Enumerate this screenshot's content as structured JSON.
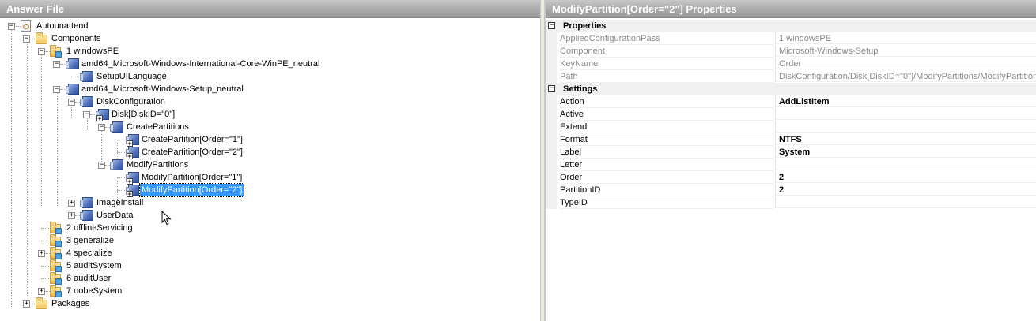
{
  "left_pane": {
    "title": "Answer File",
    "tree": [
      {
        "label": "Autounattend",
        "icon": "answer-file-icon"
      },
      {
        "label": "Components",
        "icon": "folder-icon"
      },
      {
        "label": "1 windowsPE",
        "icon": "config-pass-icon"
      },
      {
        "label": "amd64_Microsoft-Windows-International-Core-WinPE_neutral",
        "icon": "component-icon"
      },
      {
        "label": "SetupUILanguage",
        "icon": "component-icon"
      },
      {
        "label": "amd64_Microsoft-Windows-Setup_neutral",
        "icon": "component-icon"
      },
      {
        "label": "DiskConfiguration",
        "icon": "component-icon"
      },
      {
        "label": "Disk[DiskID=\"0\"]",
        "icon": "list-item-icon"
      },
      {
        "label": "CreatePartitions",
        "icon": "component-icon"
      },
      {
        "label": "CreatePartition[Order=\"1\"]",
        "icon": "list-item-icon"
      },
      {
        "label": "CreatePartition[Order=\"2\"]",
        "icon": "list-item-icon"
      },
      {
        "label": "ModifyPartitions",
        "icon": "component-icon"
      },
      {
        "label": "ModifyPartition[Order=\"1\"]",
        "icon": "list-item-icon"
      },
      {
        "label": "ModifyPartition[Order=\"2\"]",
        "icon": "list-item-icon",
        "selected": true
      },
      {
        "label": "ImageInstall",
        "icon": "component-icon"
      },
      {
        "label": "UserData",
        "icon": "component-icon"
      },
      {
        "label": "2 offlineServicing",
        "icon": "config-pass-icon"
      },
      {
        "label": "3 generalize",
        "icon": "config-pass-icon"
      },
      {
        "label": "4 specialize",
        "icon": "config-pass-icon"
      },
      {
        "label": "5 auditSystem",
        "icon": "config-pass-icon"
      },
      {
        "label": "6 auditUser",
        "icon": "config-pass-icon"
      },
      {
        "label": "7 oobeSystem",
        "icon": "config-pass-icon"
      },
      {
        "label": "Packages",
        "icon": "folder-icon"
      }
    ]
  },
  "right_pane": {
    "title": "ModifyPartition[Order=\"2\"] Properties",
    "categories": [
      {
        "name": "Properties",
        "rows": [
          {
            "name": "AppliedConfigurationPass",
            "value": "1 windowsPE"
          },
          {
            "name": "Component",
            "value": "Microsoft-Windows-Setup"
          },
          {
            "name": "KeyName",
            "value": "Order"
          },
          {
            "name": "Path",
            "value": "DiskConfiguration/Disk[DiskID=\"0\"]/ModifyPartitions/ModifyPartition"
          }
        ]
      },
      {
        "name": "Settings",
        "rows": [
          {
            "name": "Action",
            "value": "AddListItem"
          },
          {
            "name": "Active",
            "value": ""
          },
          {
            "name": "Extend",
            "value": ""
          },
          {
            "name": "Format",
            "value": "NTFS"
          },
          {
            "name": "Label",
            "value": "System"
          },
          {
            "name": "Letter",
            "value": ""
          },
          {
            "name": "Order",
            "value": "2"
          },
          {
            "name": "PartitionID",
            "value": "2"
          },
          {
            "name": "TypeID",
            "value": ""
          }
        ]
      }
    ]
  },
  "colors": {
    "selection": "#3399ff",
    "title_bar": "#a9a9a9",
    "readonly_text": "#8a8a8a"
  }
}
